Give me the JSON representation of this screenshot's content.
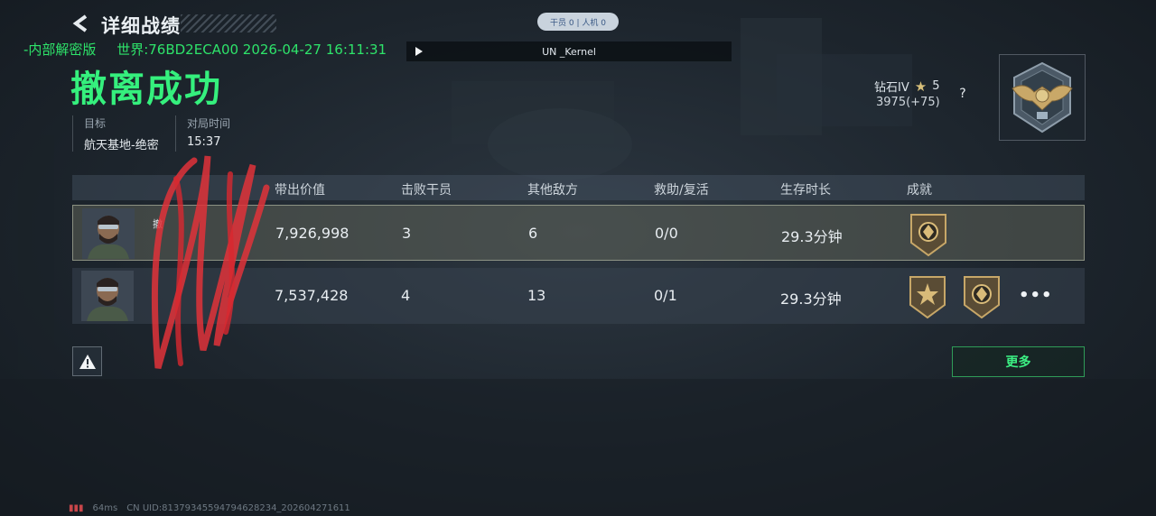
{
  "header": {
    "title": "详细战绩",
    "watermark": [
      "-内部解密版",
      "世界:76BD2ECA00 2026-04-27 16:11:31"
    ]
  },
  "status_pill": "干员 0 | 人机 0",
  "player_bar": {
    "name": "UN _Kernel"
  },
  "result": {
    "title": "撤离成功",
    "target_label": "目标",
    "target_value": "航天基地-绝密",
    "time_label": "对局时间",
    "time_value": "15:37"
  },
  "rank": {
    "tier": "钻石IV",
    "stars": "5",
    "score": "3975(+75)",
    "help": "?"
  },
  "table": {
    "headers": [
      "带出价值",
      "击败干员",
      "其他敌方",
      "救助/复活",
      "生存时长",
      "成就"
    ],
    "rows": [
      {
        "name": "撤",
        "sub": "",
        "value": "7,926,998",
        "kills": "3",
        "other": "6",
        "assist": "0/0",
        "survival": "29.3分钟",
        "medals": [
          "shield-medal"
        ]
      },
      {
        "name": "",
        "sub": "",
        "value": "7,537,428",
        "kills": "4",
        "other": "13",
        "assist": "0/1",
        "survival": "29.3分钟",
        "medals": [
          "star-medal",
          "shield-medal"
        ],
        "more": "•••"
      }
    ]
  },
  "buttons": {
    "more": "更多"
  },
  "footer": {
    "ping": "64ms",
    "uid": "CN UID:81379345594794628234_202604271611"
  },
  "colors": {
    "accent": "#35f07d",
    "watermark": "#2ee36a"
  }
}
